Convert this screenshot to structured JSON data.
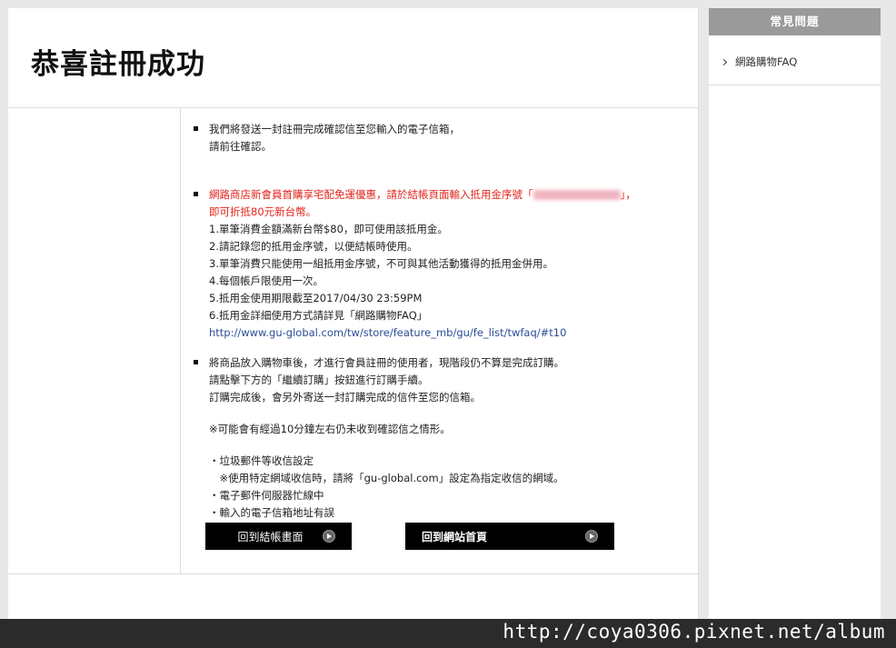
{
  "main": {
    "title": "恭喜註冊成功",
    "notices": {
      "first": [
        "我們將發送一封註冊完成確認信至您輸入的電子信箱，",
        "請前往確認。"
      ],
      "promo": {
        "red_line1_pre": "網路商店新會員首購享宅配免運優惠，請於結帳頁面輸入抵用金序號「",
        "red_line1_post": "」，",
        "red_line2": "即可折抵80元新台幣。",
        "rules": [
          "1.單筆消費金額滿新台幣$80，即可使用該抵用金。",
          "2.請記錄您的抵用金序號，以便結帳時使用。",
          "3.單筆消費只能使用一組抵用金序號，不可與其他活動獲得的抵用金併用。",
          "4.每個帳戶限使用一次。",
          "5.抵用金使用期限截至2017/04/30 23:59PM",
          "6.抵用金詳細使用方式請詳見「網路購物FAQ」"
        ],
        "faq_link": "http://www.gu-global.com/tw/store/feature_mb/gu/fe_list/twfaq/#t10"
      },
      "third": {
        "lines": [
          "將商品放入購物車後，才進行會員註冊的使用者，現階段仍不算是完成訂購。",
          "請點擊下方的「繼續訂購」按鈕進行訂購手續。",
          "訂購完成後，會另外寄送一封訂購完成的信件至您的信箱。"
        ],
        "note": "※可能會有經過10分鐘左右仍未收到確認信之情形。",
        "reasons": [
          "・垃圾郵件等收信設定",
          "　※使用特定網域收信時，請將「gu-global.com」設定為指定收信的網域。",
          "・電子郵件伺服器忙線中",
          "・輸入的電子信箱地址有誤"
        ]
      }
    },
    "buttons": {
      "back_to_cart": "回到結帳畫面",
      "back_to_home": "回到網站首頁"
    }
  },
  "sidebar": {
    "header": "常見問題",
    "items": [
      {
        "label": "網路購物FAQ"
      }
    ]
  },
  "watermark": "http://coya0306.pixnet.net/album",
  "colors": {
    "accent_red": "#e2231a",
    "link_blue": "#2a4e96",
    "sidebar_header_bg": "#9a9a9a"
  }
}
